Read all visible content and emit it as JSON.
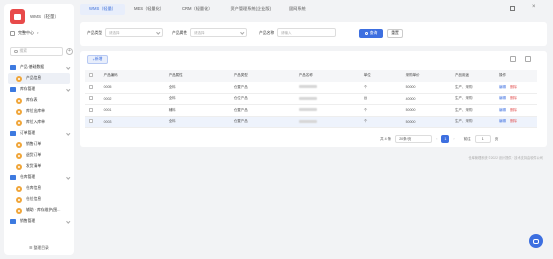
{
  "app": {
    "name": "WMS（轻量）"
  },
  "org": {
    "label": "完整中心"
  },
  "sidebar_search": {
    "placeholder": "搜索"
  },
  "menu": [
    {
      "label": "产品·基础数据",
      "type": "group"
    },
    {
      "label": "产品信息",
      "type": "child",
      "active": true
    },
    {
      "label": "库存管理",
      "type": "group"
    },
    {
      "label": "库存表",
      "type": "child"
    },
    {
      "label": "库位出库单",
      "type": "child"
    },
    {
      "label": "库位入库单",
      "type": "child"
    },
    {
      "label": "订单管理",
      "type": "group"
    },
    {
      "label": "销售订单",
      "type": "child"
    },
    {
      "label": "退货订单",
      "type": "child"
    },
    {
      "label": "发货清单",
      "type": "child"
    },
    {
      "label": "仓库管理",
      "type": "group"
    },
    {
      "label": "仓库信息",
      "type": "child"
    },
    {
      "label": "仓位信息",
      "type": "child"
    },
    {
      "label": "辅助 · 库存维护(图...",
      "type": "child"
    },
    {
      "label": "销售管理",
      "type": "group"
    }
  ],
  "collapse_label": "整理目录",
  "tabs": [
    "WMS（轻量）",
    "MES（轻量化）",
    "CRM（轻量化）",
    "资产管理系统(企业版)",
    "固网系统"
  ],
  "filters": {
    "product_type_label": "产品类型",
    "product_type_placeholder": "请选择",
    "product_attr_label": "产品属性",
    "product_attr_placeholder": "请选择",
    "product_name_label": "产品名称",
    "product_name_placeholder": "请输入",
    "query_label": "查询",
    "reset_label": "重置"
  },
  "table": {
    "add_label": "新增",
    "headers": [
      "产品编码",
      "产品属性",
      "产品类型",
      "产品名称",
      "单位",
      "采购单价",
      "产品用途",
      "操作"
    ],
    "rows": [
      [
        "0005",
        "全料",
        "仓置产品",
        "",
        "个",
        "50000",
        "生产、采购"
      ],
      [
        "0002",
        "全料",
        "仓位产品",
        "",
        "台",
        "40000",
        "生产、采购"
      ],
      [
        "0001",
        "辅料",
        "仓置产品",
        "",
        "个",
        "50000",
        "生产、采购"
      ],
      [
        "0003",
        "全料",
        "仓置产品",
        "",
        "个",
        "50000",
        "生产、采购"
      ]
    ],
    "edit_label": "编辑",
    "delete_label": "删除"
  },
  "pagination": {
    "total": "共 4 条",
    "page_size": "20条/页",
    "current": "1",
    "goto_label": "前往",
    "goto_value": "1",
    "page_unit": "页"
  },
  "footer": "仓库管理系统 ©2022 设计提供 · 技术支持由软件公司"
}
